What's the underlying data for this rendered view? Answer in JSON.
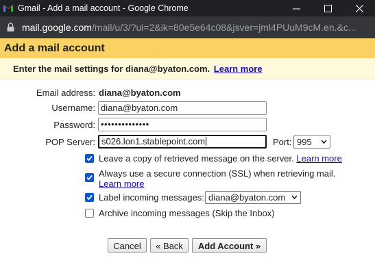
{
  "window": {
    "title": "Gmail - Add a mail account - Google Chrome",
    "url_host": "mail.google.com",
    "url_path": "/mail/u/3/?ui=2&ik=80e5e64c08&jsver=jml4PUuM9cM.en.&c..."
  },
  "dialog": {
    "title": "Add a mail account",
    "subtitle": "Enter the mail settings for diana@byaton.com.",
    "learn_more": "Learn more",
    "email_label": "Email address:",
    "email_value": "diana@byaton.com",
    "username_label": "Username:",
    "username_value": "diana@byaton.com",
    "password_label": "Password:",
    "password_value": "••••••••••••••",
    "pop_label": "POP Server:",
    "pop_value": "s026.lon1.stablepoint.com",
    "port_label": "Port:",
    "port_value": "995",
    "options": {
      "leave_copy": {
        "text": "Leave a copy of retrieved message on the server.",
        "link": "Learn more",
        "checked": true
      },
      "ssl": {
        "text": "Always use a secure connection (SSL) when retrieving mail.",
        "link": "Learn more",
        "checked": true
      },
      "label": {
        "text": "Label incoming messages:",
        "select_value": "diana@byaton.com",
        "checked": true
      },
      "archive": {
        "text": "Archive incoming messages (Skip the Inbox)",
        "checked": false
      }
    },
    "buttons": {
      "cancel": "Cancel",
      "back": "« Back",
      "add": "Add Account »"
    }
  },
  "colors": {
    "header_bg": "#fad163",
    "subheader_bg": "#fef9db",
    "checkbox_on": "#0b57d0",
    "link": "#1a0dab"
  }
}
